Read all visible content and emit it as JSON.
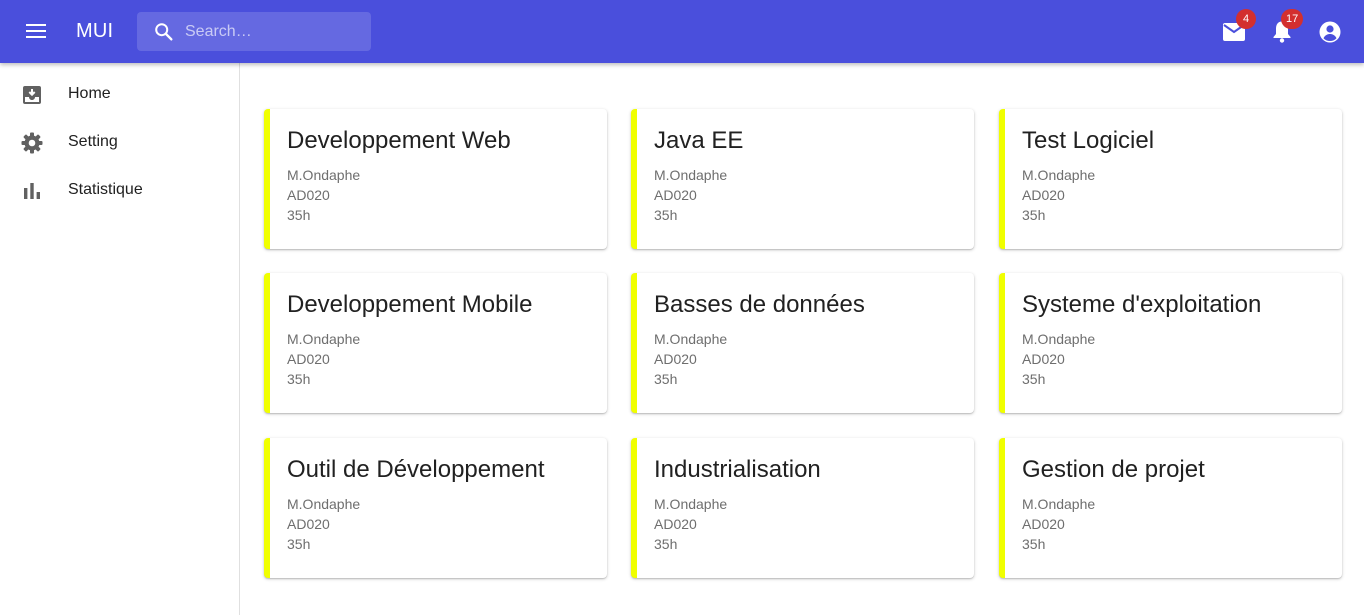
{
  "appbar": {
    "brand": "MUI",
    "search_placeholder": "Search…",
    "mail_badge": "4",
    "notifications_badge": "17"
  },
  "sidebar": {
    "items": [
      {
        "label": "Home",
        "icon": "inbox-icon"
      },
      {
        "label": "Setting",
        "icon": "gear-icon"
      },
      {
        "label": "Statistique",
        "icon": "bar-chart-icon"
      }
    ]
  },
  "colors": {
    "appbar": "#4a4fdc",
    "card_accent": "#f0ff00",
    "badge": "#d32f2f"
  },
  "cards": [
    {
      "title": "Developpement Web",
      "teacher": "M.Ondaphe",
      "room": "AD020",
      "hours": "35h"
    },
    {
      "title": "Java EE",
      "teacher": "M.Ondaphe",
      "room": "AD020",
      "hours": "35h"
    },
    {
      "title": "Test Logiciel",
      "teacher": "M.Ondaphe",
      "room": "AD020",
      "hours": "35h"
    },
    {
      "title": "Developpement Mobile",
      "teacher": "M.Ondaphe",
      "room": "AD020",
      "hours": "35h"
    },
    {
      "title": "Basses de données",
      "teacher": "M.Ondaphe",
      "room": "AD020",
      "hours": "35h"
    },
    {
      "title": "Systeme d'exploitation",
      "teacher": "M.Ondaphe",
      "room": "AD020",
      "hours": "35h"
    },
    {
      "title": "Outil de Développement",
      "teacher": "M.Ondaphe",
      "room": "AD020",
      "hours": "35h"
    },
    {
      "title": "Industrialisation",
      "teacher": "M.Ondaphe",
      "room": "AD020",
      "hours": "35h"
    },
    {
      "title": "Gestion de projet",
      "teacher": "M.Ondaphe",
      "room": "AD020",
      "hours": "35h"
    }
  ]
}
